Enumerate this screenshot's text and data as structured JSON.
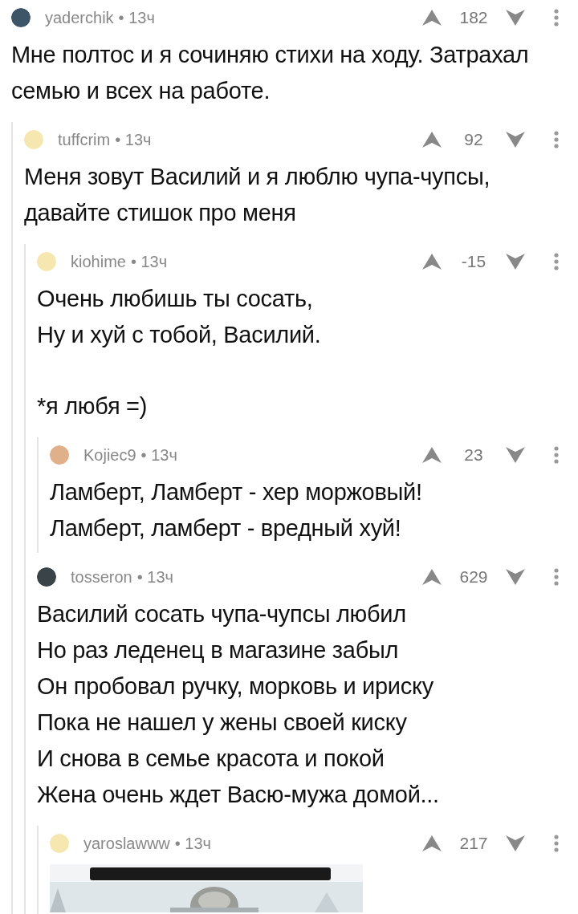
{
  "comments": [
    {
      "author": "yaderchik",
      "time": "• 13ч",
      "rating": "182",
      "color": "#3d5566",
      "paragraphs": [
        [
          "Мне полтос и я сочиняю стихи на ходу. Затрахал семью и всех на работе."
        ]
      ],
      "children": [
        {
          "author": "tuffcrim",
          "time": "• 13ч",
          "rating": "92",
          "color": "#f6e7b0",
          "paragraphs": [
            [
              "Меня зовут Василий и я люблю чупа-чупсы, давайте стишок про меня"
            ]
          ],
          "children": [
            {
              "author": "kiohime",
              "time": "• 13ч",
              "rating": "-15",
              "color": "#f6e7b0",
              "paragraphs": [
                [
                  "Очень любишь ты сосать,",
                  "Ну и хуй с тобой, Василий."
                ],
                [
                  "*я любя =)"
                ]
              ],
              "children": [
                {
                  "author": "Kojiec9",
                  "time": "• 13ч",
                  "rating": "23",
                  "color": "#e0b08a",
                  "paragraphs": [
                    [
                      "Ламберт, Ламберт - хер моржовый!",
                      "Ламберт, ламберт - вредный хуй!"
                    ]
                  ]
                }
              ]
            },
            {
              "author": "tosseron",
              "time": "• 13ч",
              "rating": "629",
              "color": "#3a4448",
              "paragraphs": [
                [
                  "Василий сосать чупа-чупсы любил",
                  "Но раз леденец в магазине забыл",
                  "Он пробовал ручку, морковь и ириску",
                  "Пока не нашел у жены своей киску",
                  "И снова в семье красота и покой",
                  "Жена очень ждет Васю-мужа домой..."
                ]
              ],
              "children": [
                {
                  "author": "yaroslawww",
                  "time": "• 13ч",
                  "rating": "217",
                  "color": "#f6e7b0"
                }
              ]
            }
          ]
        }
      ]
    }
  ]
}
